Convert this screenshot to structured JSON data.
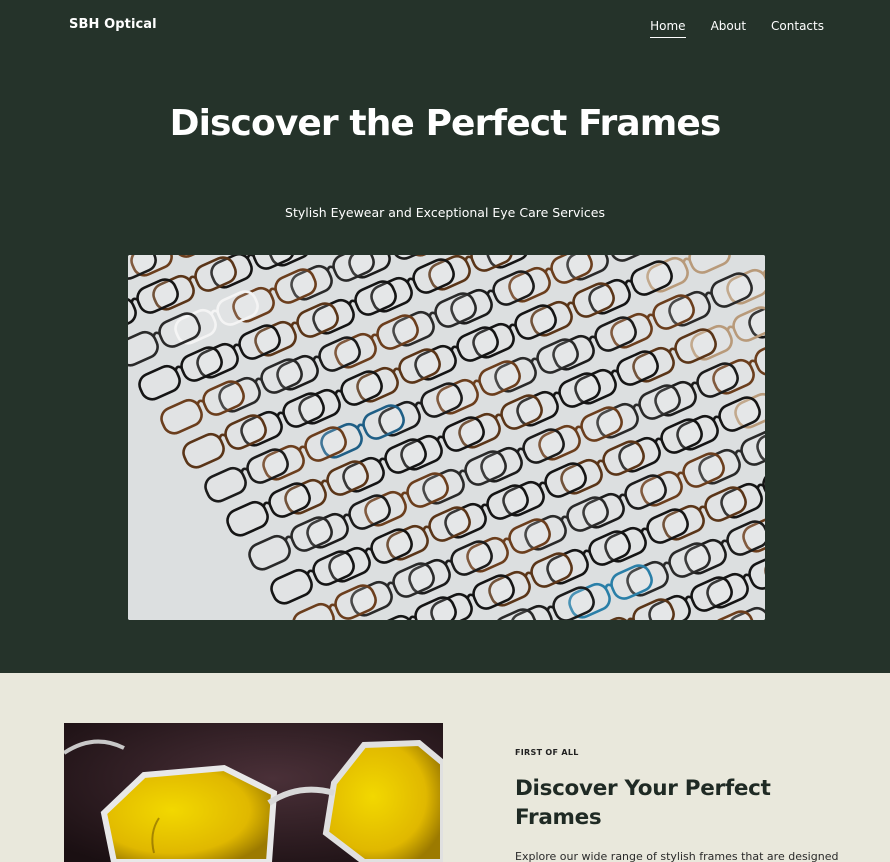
{
  "header": {
    "brand": "SBH Optical",
    "nav": [
      {
        "label": "Home",
        "active": true
      },
      {
        "label": "About",
        "active": false
      },
      {
        "label": "Contacts",
        "active": false
      }
    ]
  },
  "hero": {
    "title": "Discover the Perfect Frames",
    "subtitle": "Stylish Eyewear and Exceptional Eye Care Services"
  },
  "feature": {
    "eyebrow": "FIRST OF ALL",
    "title": "Discover Your Perfect Frames",
    "body": "Explore our wide range of stylish frames that are designed"
  },
  "colors": {
    "hero_bg": "#25332a",
    "section_bg": "#e9e8dc",
    "text_light": "#ffffff",
    "text_dark": "#1f2a24"
  }
}
